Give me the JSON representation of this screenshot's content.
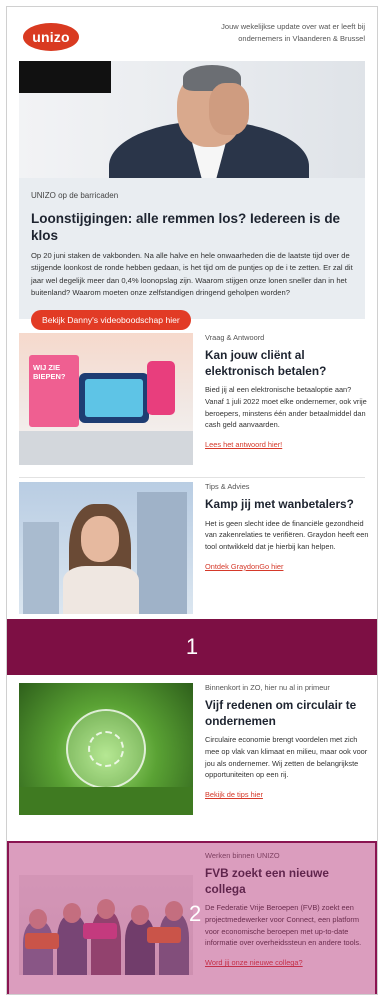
{
  "header": {
    "logo_text": "unizo",
    "tagline": "Jouw wekelijkse update over wat er leeft bij ondernemers in Vlaanderen & Brussel"
  },
  "hero": {
    "kicker": "UNIZO op de barricaden",
    "title": "Loonstijgingen: alle remmen los? Iedereen is de klos",
    "text": "Op 20 juni staken de vakbonden. Na alle halve en hele onwaarheden die de laatste tijd over de stijgende loonkost de ronde hebben gedaan, is het tijd om de puntjes op de i te zetten. Er zal dit jaar wel degelijk meer dan 0,4% loonopslag zijn. Waarom stijgen onze lonen sneller dan in het buitenland? Waarom moeten onze zelfstandigen dringend geholpen worden?",
    "button_label": "Bekijk Danny's videoboodschap hier"
  },
  "articles": [
    {
      "kicker": "Vraag & Antwoord",
      "title": "Kan jouw cliënt al elektronisch betalen?",
      "text": "Bied jij al een elektronische betaaloptie aan? Vanaf 1 juli 2022 moet elke ondernemer, ook vrije beroepers, minstens één ander betaalmiddel dan cash geld aanvaarden.",
      "link": "Lees het antwoord hier!",
      "image_sign_text": "WIJ ZIE BIEPEN?"
    },
    {
      "kicker": "Tips & Advies",
      "title": "Kamp jij met wanbetalers?",
      "text": "Het is geen slecht idee de financiële gezondheid van zakenrelaties te verifiëren. Graydon heeft een tool ontwikkeld dat je hierbij kan helpen.",
      "link": "Ontdek GraydonGo hier"
    },
    {
      "kicker": "Binnenkort in ZO, hier nu al in primeur",
      "title": "Vijf redenen om circulair te ondernemen",
      "text": "Circulaire economie brengt voordelen met zich mee op vlak van klimaat en milieu, maar ook voor jou als ondernemer. Wij zetten de belangrijkste opportuniteiten op een rij.",
      "link": "Bekijk de tips hier"
    },
    {
      "kicker": "Werken binnen UNIZO",
      "title": "FVB zoekt een nieuwe collega",
      "text": "De Federatie Vrije Beroepen (FVB) zoekt een projectmedewerker voor Connect, een platform voor economische beroepen met up-to-date informatie over overheidssteun en andere tools.",
      "link": "Word jij onze nieuwe collega?"
    }
  ],
  "banner": {
    "number": "1"
  },
  "overlay": {
    "number": "2"
  },
  "colors": {
    "brand_red": "#e23b25",
    "banner_purple": "#7d0f44",
    "overlay_pink": "#b0266e",
    "link_red": "#d5392a"
  }
}
